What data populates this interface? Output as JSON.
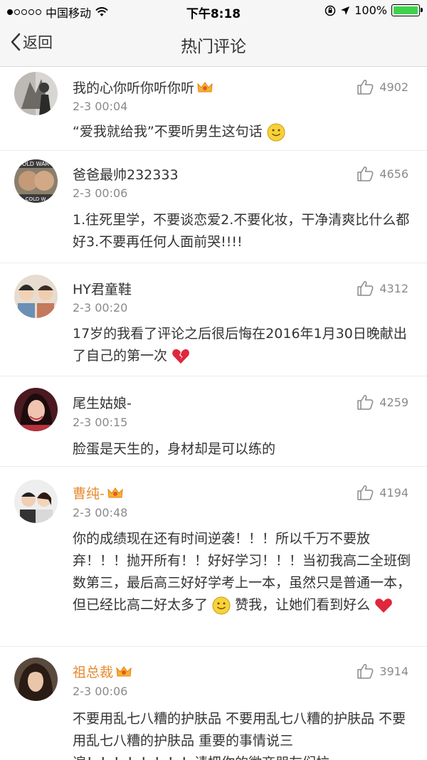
{
  "statusbar": {
    "carrier": "中国移动",
    "time": "下午8:18",
    "battery": "100%"
  },
  "navbar": {
    "back_label": "返回",
    "title": "热门评论"
  },
  "comments": [
    {
      "user": "我的心你听你听你听",
      "time": "2-3 00:04",
      "likes": "4902",
      "text": "“爱我就给我”不要听男生这句话"
    },
    {
      "user": "爸爸最帅232333",
      "time": "2-3 00:06",
      "likes": "4656",
      "text": "1.往死里学，不要谈恋爱2.不要化妆，干净清爽比什么都好3.不要再任何人面前哭!!!!"
    },
    {
      "user": "HY君童鞋",
      "time": "2-3 00:20",
      "likes": "4312",
      "text": "17岁的我看了评论之后很后悔在2016年1月30日晚献出了自己的第一次"
    },
    {
      "user": "尾生姑娘-",
      "time": "2-3 00:15",
      "likes": "4259",
      "text": "脸蛋是天生的，身材却是可以练的"
    },
    {
      "user": "曹纯-",
      "time": "2-3 00:48",
      "likes": "4194",
      "text_a": "你的成绩现在还有时间逆袭！！！所以千万不要放弃！！！抛开所有！！好好学习！！！当初我高二全班倒数第三，最后高三好好学考上一本，虽然只是普通一本，但已经比高二好太多了",
      "text_b": "赞我，让她们看到好么"
    },
    {
      "user": "祖总裁",
      "time": "2-3 00:06",
      "likes": "3914",
      "text": "不要用乱七八糟的护肤品 不要用乱七八糟的护肤品 不要用乱七八糟的护肤品 重要的事情说三遍！！！！！！！！请把你的微商朋友们拉"
    }
  ],
  "colors": {
    "orange_name": "#e68a2e",
    "battery_green": "#3fd24a"
  }
}
